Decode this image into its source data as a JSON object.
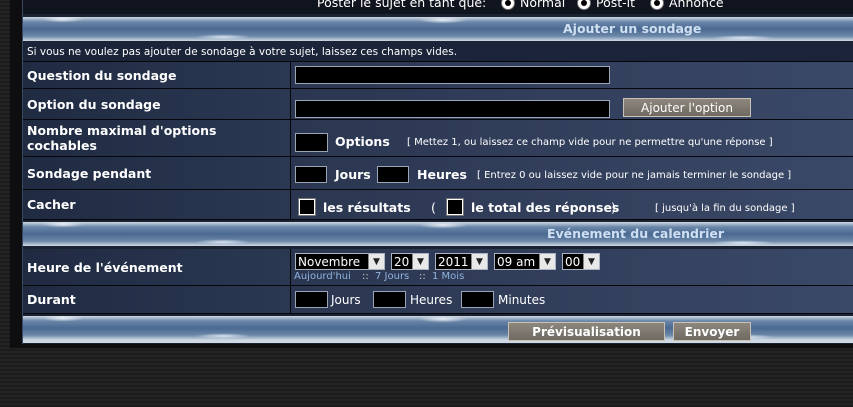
{
  "top": {
    "post_as": "Poster le sujet en tant que:",
    "options": [
      "Normal",
      "Post-it",
      "Annonce"
    ]
  },
  "poll": {
    "header": "Ajouter un sondage",
    "notice": "Si vous ne voulez pas ajouter de sondage à votre sujet, laissez ces champs vides.",
    "question_label": "Question du sondage",
    "option_label": "Option du sondage",
    "add_option": "Ajouter l'option",
    "max_label": "Nombre maximal d'options cochables",
    "max_unit": "Options",
    "max_hint": "[ Mettez 1, ou laissez ce champ vide pour ne permettre qu'une réponse ]",
    "duration_label": "Sondage pendant",
    "days": "Jours",
    "hours": "Heures",
    "duration_hint": "[ Entrez 0 ou laissez vide pour ne jamais terminer le sondage ]",
    "hide_label": "Cacher",
    "hide_results": "les résultats",
    "paren_open": "(",
    "hide_total": "le total des réponses",
    "paren_close": ")",
    "hide_hint": "[ jusqu'à la fin du sondage ]"
  },
  "event": {
    "header": "Evénement du calendrier",
    "time_label": "Heure de l'événement",
    "month": "Novembre",
    "day": "20",
    "year": "2011",
    "hour": "09 am",
    "minute": "00",
    "today": "Aujourd'hui",
    "sep1": "::",
    "days7": "7 Jours",
    "sep2": "::",
    "month1": "1 Mois",
    "during_label": "Durant",
    "days": "Jours",
    "hours": "Heures",
    "minutes": "Minutes"
  },
  "actions": {
    "preview": "Prévisualisation",
    "send": "Envoyer"
  }
}
